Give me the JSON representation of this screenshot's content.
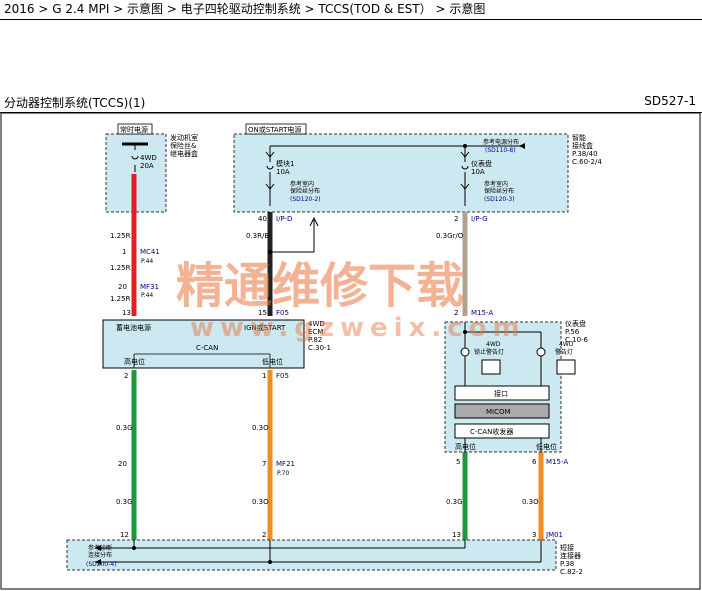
{
  "breadcrumb": "2016 > G 2.4 MPI > 示意图 > 电子四轮驱动控制系统 > TCCS(TOD & EST） > 示意图",
  "title": "分动器控制系统(TCCS)(1)",
  "code": "SD527-1",
  "watermark": {
    "cn": "精通维修下载",
    "url": "www.gzweix.com"
  },
  "fusebox1": {
    "header": "常时电源",
    "side_label_1": "发动机室",
    "side_label_2": "保险丝&",
    "side_label_3": "继电器盒",
    "fuse_name": "4WD",
    "fuse_rating": "20A"
  },
  "fusebox2": {
    "header": "ON或START电源",
    "side_label_1": "智能",
    "side_label_2": "接线盒",
    "side_label_3": "P.38/40",
    "side_label_4": "C.60-2/4",
    "ref_top_1": "参考电源分布",
    "ref_top_2": "(SD110-8)",
    "fuse1_name": "模块1",
    "fuse1_rating": "10A",
    "fuse2_name": "仪表盘",
    "fuse2_rating": "10A",
    "ref_left_1": "参考室内",
    "ref_left_2": "保险丝分布",
    "ref_left_3": "(SD120-2)",
    "ref_right_1": "参考室内",
    "ref_right_2": "保险丝分布",
    "ref_right_3": "(SD120-3)"
  },
  "wires": {
    "w1_size_a": "1.25R",
    "w1_pin_a": "1",
    "w1_conn_a": "MC41",
    "w1_page_a": "P.44",
    "w1_size_b": "1.25R",
    "w1_pin_b": "20",
    "w1_conn_b": "MF31",
    "w1_page_b": "P.44",
    "w1_size_c": "1.25R",
    "w1_pin_c": "13",
    "w2_pin_top": "40",
    "w2_conn_top": "I/P-D",
    "w2_size": "0.3R/B",
    "w2_pin_bot": "15",
    "w2_conn_bot": "F05",
    "w3_pin_top": "2",
    "w3_conn_top": "I/P-G",
    "w3_size": "0.3Gr/O",
    "w3_pin_bot": "2",
    "w3_conn_bot": "M15-A"
  },
  "module": {
    "label_power": "蓄电池电源",
    "label_ign": "IGN或START",
    "label_can": "C-CAN",
    "label_high": "高电位",
    "label_low": "低电位",
    "side_1": "4WD",
    "side_2": "ECM",
    "side_3": "P.82",
    "side_4": "C.30-1"
  },
  "lower_wires": {
    "g_pin_top": "2",
    "g_size_a": "0.3G",
    "g_pin_mid": "20",
    "g_size_b": "0.3G",
    "g_pin_bot": "12",
    "o_pin_top": "1",
    "o_conn_top": "F05",
    "o_size_a": "0.3O",
    "o_pin_mid": "7",
    "o_conn_mid": "MF21",
    "o_page_mid": "P.70",
    "o_size_b": "0.3O",
    "o_pin_bot": "2",
    "cg_pin_top": "5",
    "cg_size": "0.3G",
    "cg_pin_bot": "13",
    "co_pin_top": "6",
    "co_conn_top": "M15-A",
    "co_size": "0.3O",
    "co_pin_bot": "3",
    "co_conn_bot": "JM01"
  },
  "cluster": {
    "side_1": "仪表盘",
    "side_2": "P.56",
    "side_3": "C.10-6",
    "lamp1_1": "4WD",
    "lamp1_2": "锁止警告灯",
    "lamp2_1": "4WD",
    "lamp2_2": "警告灯",
    "block_interface": "接口",
    "block_micom": "MICOM",
    "block_can": "C-CAN收发器",
    "label_high": "高电位",
    "label_low": "低电位"
  },
  "joint": {
    "ref_1": "参考诊断",
    "ref_2": "连接分布",
    "ref_3": "(SD200-4)",
    "side_1": "短接",
    "side_2": "连接器",
    "side_3": "P.38",
    "side_4": "C.82-2"
  },
  "colors": {
    "panel": "#cce8f0",
    "red": "#e02020",
    "green": "#1a9a3a",
    "orange": "#f08c20",
    "gray_orange": "#b4a08c",
    "watermark": "#e8723a"
  }
}
